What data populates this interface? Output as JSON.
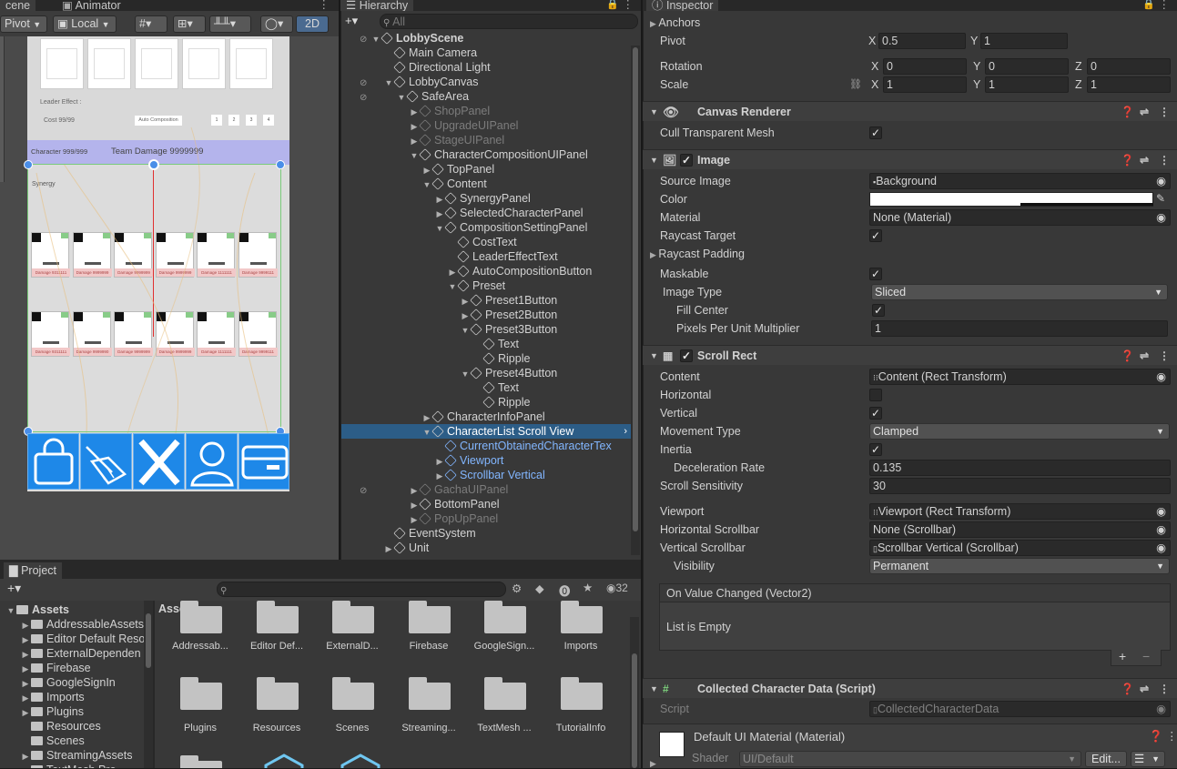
{
  "tabs": {
    "scene": "cene",
    "animator": "Animator",
    "hierarchy": "Hierarchy",
    "inspector": "Inspector",
    "project": "Project"
  },
  "scene_toolbar": {
    "pivot": "Pivot",
    "local": "Local",
    "mode2d": "2D"
  },
  "hierarchy": {
    "search_placeholder": "All",
    "rows": [
      {
        "label": "LobbyScene",
        "depth": 0,
        "arrow": "▼",
        "style": "root"
      },
      {
        "label": "Main Camera",
        "depth": 1,
        "arrow": "",
        "style": ""
      },
      {
        "label": "Directional Light",
        "depth": 1,
        "arrow": "",
        "style": ""
      },
      {
        "label": "LobbyCanvas",
        "depth": 1,
        "arrow": "▼",
        "style": ""
      },
      {
        "label": "SafeArea",
        "depth": 2,
        "arrow": "▼",
        "style": ""
      },
      {
        "label": "ShopPanel",
        "depth": 3,
        "arrow": "▶",
        "style": "dim"
      },
      {
        "label": "UpgradeUIPanel",
        "depth": 3,
        "arrow": "▶",
        "style": "dim"
      },
      {
        "label": "StageUIPanel",
        "depth": 3,
        "arrow": "▶",
        "style": "dim"
      },
      {
        "label": "CharacterCompositionUIPanel",
        "depth": 3,
        "arrow": "▼",
        "style": ""
      },
      {
        "label": "TopPanel",
        "depth": 4,
        "arrow": "▶",
        "style": ""
      },
      {
        "label": "Content",
        "depth": 4,
        "arrow": "▼",
        "style": ""
      },
      {
        "label": "SynergyPanel",
        "depth": 5,
        "arrow": "▶",
        "style": ""
      },
      {
        "label": "SelectedCharacterPanel",
        "depth": 5,
        "arrow": "▶",
        "style": ""
      },
      {
        "label": "CompositionSettingPanel",
        "depth": 5,
        "arrow": "▼",
        "style": ""
      },
      {
        "label": "CostText",
        "depth": 6,
        "arrow": "",
        "style": ""
      },
      {
        "label": "LeaderEffectText",
        "depth": 6,
        "arrow": "",
        "style": ""
      },
      {
        "label": "AutoCompositionButton",
        "depth": 6,
        "arrow": "▶",
        "style": ""
      },
      {
        "label": "Preset",
        "depth": 6,
        "arrow": "▼",
        "style": ""
      },
      {
        "label": "Preset1Button",
        "depth": 7,
        "arrow": "▶",
        "style": ""
      },
      {
        "label": "Preset2Button",
        "depth": 7,
        "arrow": "▶",
        "style": ""
      },
      {
        "label": "Preset3Button",
        "depth": 7,
        "arrow": "▼",
        "style": ""
      },
      {
        "label": "Text",
        "depth": 8,
        "arrow": "",
        "style": ""
      },
      {
        "label": "Ripple",
        "depth": 8,
        "arrow": "",
        "style": ""
      },
      {
        "label": "Preset4Button",
        "depth": 7,
        "arrow": "▼",
        "style": ""
      },
      {
        "label": "Text",
        "depth": 8,
        "arrow": "",
        "style": ""
      },
      {
        "label": "Ripple",
        "depth": 8,
        "arrow": "",
        "style": ""
      },
      {
        "label": "CharacterInfoPanel",
        "depth": 4,
        "arrow": "▶",
        "style": ""
      },
      {
        "label": "CharacterList Scroll View",
        "depth": 4,
        "arrow": "▼",
        "style": "sel"
      },
      {
        "label": "CurrentObtainedCharacterTex",
        "depth": 5,
        "arrow": "",
        "style": "blue"
      },
      {
        "label": "Viewport",
        "depth": 5,
        "arrow": "▶",
        "style": "blue"
      },
      {
        "label": "Scrollbar Vertical",
        "depth": 5,
        "arrow": "▶",
        "style": "blue"
      },
      {
        "label": "GachaUIPanel",
        "depth": 3,
        "arrow": "▶",
        "style": "dim"
      },
      {
        "label": "BottomPanel",
        "depth": 3,
        "arrow": "▶",
        "style": ""
      },
      {
        "label": "PopUpPanel",
        "depth": 3,
        "arrow": "▶",
        "style": "dim"
      },
      {
        "label": "EventSystem",
        "depth": 1,
        "arrow": "",
        "style": ""
      },
      {
        "label": "Unit",
        "depth": 1,
        "arrow": "▶",
        "style": ""
      }
    ]
  },
  "game_view": {
    "leader_effect": "Leader Effect :",
    "cost": "Cost 99/99",
    "auto_comp": "Auto Composition",
    "presets": [
      "1",
      "2",
      "3",
      "4"
    ],
    "character_count": "Character 999/999",
    "team_damage": "Team Damage 9999999",
    "synergy": "Synergy",
    "damage_labels_row1": [
      "Damage 9311111",
      "Damage 9999999",
      "Damage 9999999",
      "Damage 9999999",
      "Damage 1111111",
      "Damage 9999111"
    ],
    "damage_labels_row2": [
      "Damage 9311111",
      "Damage 9999990",
      "Damage 9999999",
      "Damage 9999999",
      "Damage 1111111",
      "Damage 9999111"
    ]
  },
  "project": {
    "count": "32",
    "assets_label": "Assets",
    "tree": [
      {
        "label": "Assets",
        "depth": 0,
        "arrow": "▼",
        "bold": true
      },
      {
        "label": "AddressableAssets",
        "depth": 1,
        "arrow": "▶"
      },
      {
        "label": "Editor Default Reso",
        "depth": 1,
        "arrow": "▶"
      },
      {
        "label": "ExternalDependen",
        "depth": 1,
        "arrow": "▶"
      },
      {
        "label": "Firebase",
        "depth": 1,
        "arrow": "▶"
      },
      {
        "label": "GoogleSignIn",
        "depth": 1,
        "arrow": "▶"
      },
      {
        "label": "Imports",
        "depth": 1,
        "arrow": "▶"
      },
      {
        "label": "Plugins",
        "depth": 1,
        "arrow": "▶"
      },
      {
        "label": "Resources",
        "depth": 1,
        "arrow": ""
      },
      {
        "label": "Scenes",
        "depth": 1,
        "arrow": ""
      },
      {
        "label": "StreamingAssets",
        "depth": 1,
        "arrow": "▶"
      },
      {
        "label": "TextMesh Pro",
        "depth": 1,
        "arrow": "▶"
      }
    ],
    "grid_row1": [
      "Addressab...",
      "Editor Def...",
      "ExternalD...",
      "Firebase",
      "GoogleSign...",
      "Imports"
    ],
    "grid_row2": [
      "Plugins",
      "Resources",
      "Scenes",
      "Streaming...",
      "TextMesh ...",
      "TutorialInfo"
    ]
  },
  "inspector": {
    "anchors": "Anchors",
    "pivot": {
      "label": "Pivot",
      "x": "0.5",
      "y": "1"
    },
    "rotation": {
      "label": "Rotation",
      "x": "0",
      "y": "0",
      "z": "0"
    },
    "scale": {
      "label": "Scale",
      "x": "1",
      "y": "1",
      "z": "1"
    },
    "axis": {
      "x": "X",
      "y": "Y",
      "z": "Z"
    },
    "canvas_renderer": {
      "title": "Canvas Renderer",
      "cull": "Cull Transparent Mesh"
    },
    "image": {
      "title": "Image",
      "source_image": "Source Image",
      "source_value": "Background",
      "color": "Color",
      "material": "Material",
      "material_value": "None (Material)",
      "raycast_target": "Raycast Target",
      "raycast_padding": "Raycast Padding",
      "maskable": "Maskable",
      "image_type": "Image Type",
      "image_type_value": "Sliced",
      "fill_center": "Fill Center",
      "ppu": "Pixels Per Unit Multiplier",
      "ppu_value": "1"
    },
    "scroll_rect": {
      "title": "Scroll Rect",
      "content": "Content",
      "content_value": "Content (Rect Transform)",
      "horizontal": "Horizontal",
      "vertical": "Vertical",
      "movement": "Movement Type",
      "movement_value": "Clamped",
      "inertia": "Inertia",
      "decel": "Deceleration Rate",
      "decel_value": "0.135",
      "sensitivity": "Scroll Sensitivity",
      "sensitivity_value": "30",
      "viewport": "Viewport",
      "viewport_value": "Viewport (Rect Transform)",
      "hscroll": "Horizontal Scrollbar",
      "hscroll_value": "None (Scrollbar)",
      "vscroll": "Vertical Scrollbar",
      "vscroll_value": "Scrollbar Vertical (Scrollbar)",
      "visibility": "Visibility",
      "visibility_value": "Permanent",
      "event": "On Value Changed (Vector2)",
      "event_empty": "List is Empty",
      "plus": "+",
      "minus": "−"
    },
    "script_comp": {
      "title": "Collected Character Data (Script)",
      "script": "Script",
      "script_value": "CollectedCharacterData"
    },
    "material": {
      "title": "Default UI Material (Material)",
      "shader": "Shader",
      "shader_value": "UI/Default",
      "edit": "Edit..."
    }
  },
  "colors": {
    "selection": "#2c5d87",
    "accent_blue": "#1e88e8",
    "panel": "#383838"
  }
}
